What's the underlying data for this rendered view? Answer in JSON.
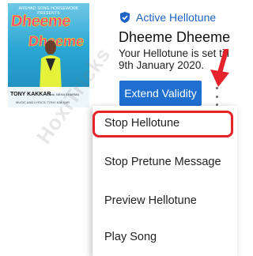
{
  "album_art": {
    "label_top": "ARSHAD SONG HORSEWORK PRESENTS",
    "title_line1": "Dheeme",
    "title_line2": "Dheeme",
    "artist": "TONY KAKKAR",
    "featuring": "feat. NEHA SHARMA",
    "credits": "MUSIC AND LYRICS: TONY KAKKAR"
  },
  "status_badge": {
    "label": "Active Hellotune",
    "color": "#1d62c4"
  },
  "song": {
    "title": "Dheeme Dheeme",
    "info_line1": "Your Hellotune is set till",
    "info_line2": "9th January 2020."
  },
  "actions": {
    "extend_label": "Extend Validity",
    "more_icon": "kebab-menu-icon"
  },
  "menu": {
    "items": [
      {
        "label": "Stop Hellotune"
      },
      {
        "label": "Stop Pretune Message"
      },
      {
        "label": "Preview Hellotune"
      },
      {
        "label": "Play Song"
      }
    ],
    "highlight_color": "#e6222a"
  },
  "watermark": {
    "text": "HoxiTricks"
  },
  "colors": {
    "accent": "#1e6fd0",
    "arrow": "#e6222a"
  }
}
